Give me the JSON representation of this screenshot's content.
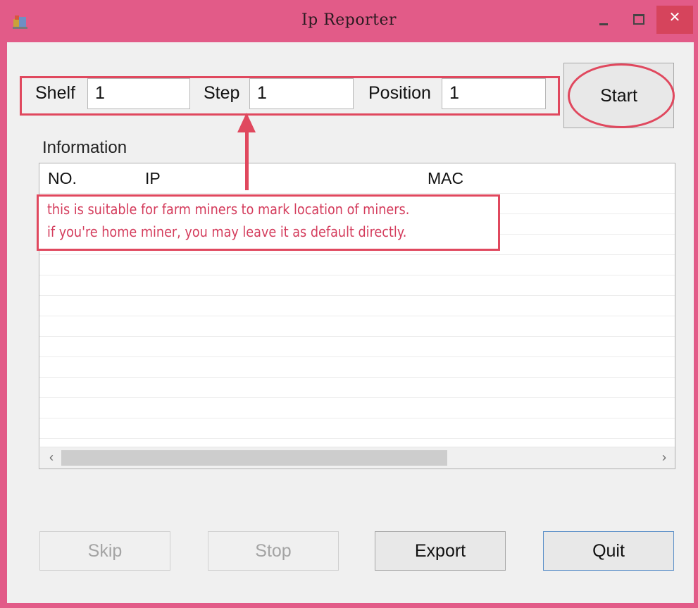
{
  "window": {
    "title": "Ip Reporter",
    "title_bar_color": "#e25b88",
    "close_icon": "close-icon",
    "close_glyph": "✕",
    "minimize_icon": "minimize-icon",
    "maximize_icon": "maximize-icon"
  },
  "fields": {
    "shelf": {
      "label": "Shelf",
      "value": "1"
    },
    "step": {
      "label": "Step",
      "value": "1"
    },
    "position": {
      "label": "Position",
      "value": "1"
    }
  },
  "start_label": "Start",
  "information": {
    "label": "Information",
    "columns": [
      "NO.",
      "IP",
      "MAC"
    ],
    "rows": []
  },
  "annotation": {
    "line1": "this is suitable for farm miners to mark location of miners.",
    "line2": "if you're home miner, you may leave it as default directly.",
    "color": "#e0485e"
  },
  "scrollbar": {
    "left_arrow": "‹",
    "right_arrow": "›"
  },
  "buttons": {
    "skip": "Skip",
    "stop": "Stop",
    "export": "Export",
    "quit": "Quit"
  }
}
